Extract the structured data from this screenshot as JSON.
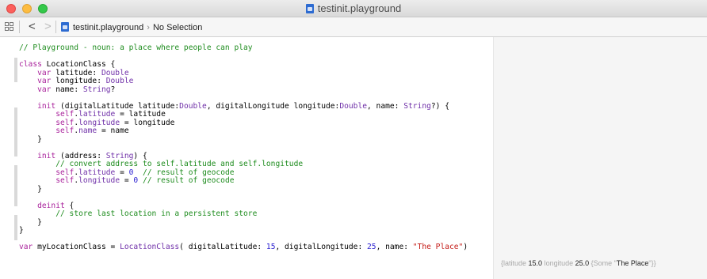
{
  "window": {
    "title": "testinit.playground"
  },
  "jumpbar": {
    "back_glyph": "<",
    "forward_glyph": ">",
    "crumbs": [
      "testinit.playground",
      "No Selection"
    ],
    "crumb_separator": "›"
  },
  "code_lines": [
    [
      {
        "t": "// Playground - noun: a place where people can play",
        "c": "com"
      }
    ],
    [
      {
        "t": "",
        "c": ""
      }
    ],
    [
      {
        "t": "class",
        "c": "kw"
      },
      {
        "t": " LocationClass {",
        "c": ""
      }
    ],
    [
      {
        "t": "    ",
        "c": ""
      },
      {
        "t": "var",
        "c": "kw"
      },
      {
        "t": " latitude: ",
        "c": ""
      },
      {
        "t": "Double",
        "c": "typ"
      }
    ],
    [
      {
        "t": "    ",
        "c": ""
      },
      {
        "t": "var",
        "c": "kw"
      },
      {
        "t": " longitude: ",
        "c": ""
      },
      {
        "t": "Double",
        "c": "typ"
      }
    ],
    [
      {
        "t": "    ",
        "c": ""
      },
      {
        "t": "var",
        "c": "kw"
      },
      {
        "t": " name: ",
        "c": ""
      },
      {
        "t": "String",
        "c": "typ"
      },
      {
        "t": "?",
        "c": ""
      }
    ],
    [
      {
        "t": "",
        "c": ""
      }
    ],
    [
      {
        "t": "    ",
        "c": ""
      },
      {
        "t": "init",
        "c": "kw"
      },
      {
        "t": " (digitalLatitude latitude:",
        "c": ""
      },
      {
        "t": "Double",
        "c": "typ"
      },
      {
        "t": ", digitalLongitude longitude:",
        "c": ""
      },
      {
        "t": "Double",
        "c": "typ"
      },
      {
        "t": ", name: ",
        "c": ""
      },
      {
        "t": "String",
        "c": "typ"
      },
      {
        "t": "?) {",
        "c": ""
      }
    ],
    [
      {
        "t": "        ",
        "c": ""
      },
      {
        "t": "self",
        "c": "kw"
      },
      {
        "t": ".",
        "c": ""
      },
      {
        "t": "latitude",
        "c": "prop"
      },
      {
        "t": " = latitude",
        "c": ""
      }
    ],
    [
      {
        "t": "        ",
        "c": ""
      },
      {
        "t": "self",
        "c": "kw"
      },
      {
        "t": ".",
        "c": ""
      },
      {
        "t": "longitude",
        "c": "prop"
      },
      {
        "t": " = longitude",
        "c": ""
      }
    ],
    [
      {
        "t": "        ",
        "c": ""
      },
      {
        "t": "self",
        "c": "kw"
      },
      {
        "t": ".",
        "c": ""
      },
      {
        "t": "name",
        "c": "prop"
      },
      {
        "t": " = name",
        "c": ""
      }
    ],
    [
      {
        "t": "    }",
        "c": ""
      }
    ],
    [
      {
        "t": "",
        "c": ""
      }
    ],
    [
      {
        "t": "    ",
        "c": ""
      },
      {
        "t": "init",
        "c": "kw"
      },
      {
        "t": " (address: ",
        "c": ""
      },
      {
        "t": "String",
        "c": "typ"
      },
      {
        "t": ") {",
        "c": ""
      }
    ],
    [
      {
        "t": "        ",
        "c": ""
      },
      {
        "t": "// convert address to self.latitude and self.longitude",
        "c": "com"
      }
    ],
    [
      {
        "t": "        ",
        "c": ""
      },
      {
        "t": "self",
        "c": "kw"
      },
      {
        "t": ".",
        "c": ""
      },
      {
        "t": "latitude",
        "c": "prop"
      },
      {
        "t": " = ",
        "c": ""
      },
      {
        "t": "0",
        "c": "num"
      },
      {
        "t": "  ",
        "c": ""
      },
      {
        "t": "// result of geocode",
        "c": "com"
      }
    ],
    [
      {
        "t": "        ",
        "c": ""
      },
      {
        "t": "self",
        "c": "kw"
      },
      {
        "t": ".",
        "c": ""
      },
      {
        "t": "longitude",
        "c": "prop"
      },
      {
        "t": " = ",
        "c": ""
      },
      {
        "t": "0",
        "c": "num"
      },
      {
        "t": " ",
        "c": ""
      },
      {
        "t": "// result of geocode",
        "c": "com"
      }
    ],
    [
      {
        "t": "    }",
        "c": ""
      }
    ],
    [
      {
        "t": "",
        "c": ""
      }
    ],
    [
      {
        "t": "    ",
        "c": ""
      },
      {
        "t": "deinit",
        "c": "kw"
      },
      {
        "t": " {",
        "c": ""
      }
    ],
    [
      {
        "t": "        ",
        "c": ""
      },
      {
        "t": "// store last location in a persistent store",
        "c": "com"
      }
    ],
    [
      {
        "t": "    }",
        "c": ""
      }
    ],
    [
      {
        "t": "}",
        "c": ""
      }
    ],
    [
      {
        "t": "",
        "c": ""
      }
    ],
    [
      {
        "t": "var",
        "c": "kw"
      },
      {
        "t": " myLocationClass = ",
        "c": ""
      },
      {
        "t": "LocationClass",
        "c": "cls"
      },
      {
        "t": "( digitalLatitude: ",
        "c": ""
      },
      {
        "t": "15",
        "c": "num"
      },
      {
        "t": ", digitalLongitude: ",
        "c": ""
      },
      {
        "t": "25",
        "c": "num"
      },
      {
        "t": ", name: ",
        "c": ""
      },
      {
        "t": "\"The Place\"",
        "c": "str"
      },
      {
        "t": ")",
        "c": ""
      }
    ]
  ],
  "result": {
    "segments": [
      {
        "t": "{latitude ",
        "c": ""
      },
      {
        "t": "15.0",
        "c": "v"
      },
      {
        "t": " longitude ",
        "c": ""
      },
      {
        "t": "25.0",
        "c": "v"
      },
      {
        "t": " {Some \"",
        "c": ""
      },
      {
        "t": "The Place",
        "c": "v"
      },
      {
        "t": "\"}}",
        "c": ""
      }
    ]
  },
  "colors": {
    "keyword": "#a9219b",
    "type": "#6f2fa8",
    "comment": "#1e8c1e",
    "number": "#2c21d1",
    "string": "#c41a16",
    "results_bg": "#f5f5f5"
  },
  "icons": [
    "close-light-icon",
    "minimize-light-icon",
    "zoom-light-icon",
    "playground-file-icon",
    "grid-icon"
  ]
}
